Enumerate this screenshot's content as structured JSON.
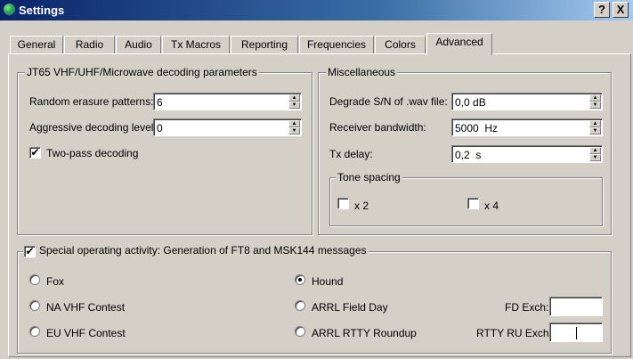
{
  "window": {
    "title": "Settings",
    "help_label": "?",
    "close_label": "X"
  },
  "tabs": [
    {
      "label": "General"
    },
    {
      "label": "Radio"
    },
    {
      "label": "Audio"
    },
    {
      "label": "Tx Macros"
    },
    {
      "label": "Reporting"
    },
    {
      "label": "Frequencies"
    },
    {
      "label": "Colors"
    },
    {
      "label": "Advanced",
      "active": true
    }
  ],
  "jt65": {
    "title": "JT65 VHF/UHF/Microwave decoding parameters",
    "random_erasure_label": "Random erasure patterns:",
    "random_erasure_value": "6",
    "aggressive_label": "Aggressive decoding level:",
    "aggressive_value": "0",
    "two_pass_label": "Two-pass decoding",
    "two_pass_checked": true
  },
  "misc": {
    "title": "Miscellaneous",
    "degrade_label": "Degrade S/N of .wav file:",
    "degrade_value": "0,0 dB",
    "bandwidth_label": "Receiver bandwidth:",
    "bandwidth_value": "5000  Hz",
    "tx_delay_label": "Tx delay:",
    "tx_delay_value": "0,2  s",
    "tone_spacing": {
      "title": "Tone spacing",
      "x2_label": "x 2",
      "x2_checked": false,
      "x4_label": "x 4",
      "x4_checked": false
    }
  },
  "special": {
    "checked": true,
    "title": "Special operating activity:  Generation of FT8 and MSK144 messages",
    "options": {
      "fox": "Fox",
      "na_vhf": "NA VHF Contest",
      "eu_vhf": "EU VHF Contest",
      "hound": "Hound",
      "arrl_field_day": "ARRL Field Day",
      "arrl_rtty": "ARRL RTTY Roundup"
    },
    "selected": "Hound",
    "fd_exch_label": "FD Exch:",
    "fd_exch_value": "",
    "rtty_exch_label": "RTTY RU Exch:",
    "rtty_exch_value": ""
  },
  "glyphs": {
    "check": "✔",
    "up": "▲",
    "down": "▼"
  }
}
